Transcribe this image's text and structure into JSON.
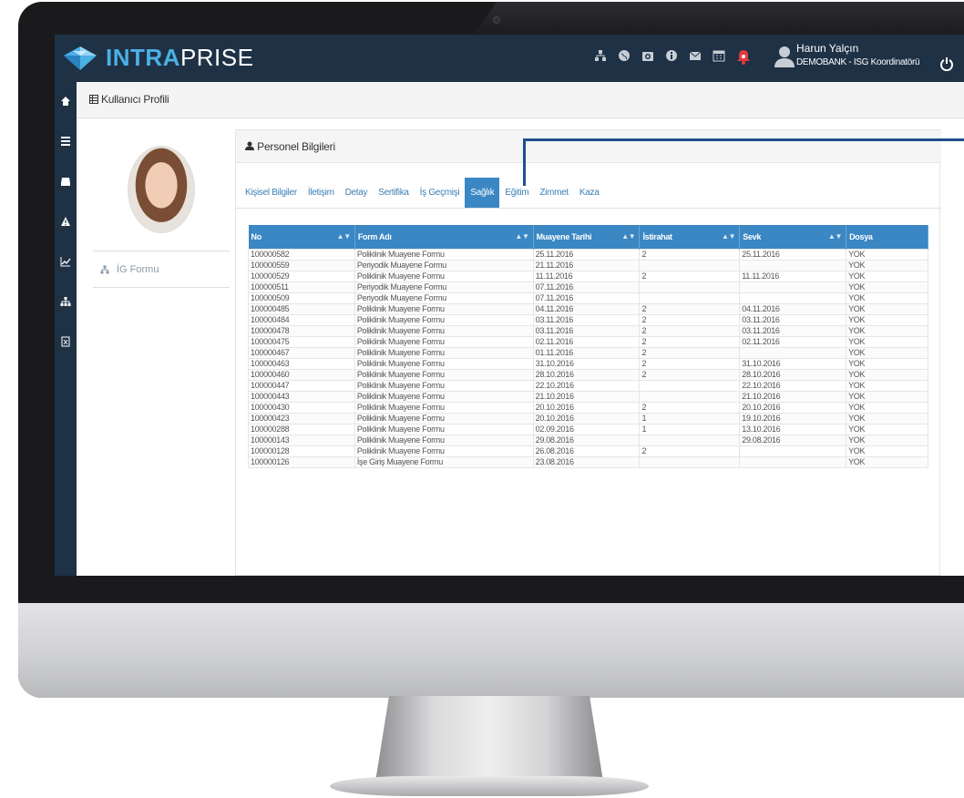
{
  "header": {
    "logo_part1": "INTRA",
    "logo_part2": "PRISE",
    "user_name": "Harun Yalçın",
    "user_role": "DEMOBANK - ISG Koordinatörü",
    "icons": [
      "sitemap-icon",
      "globe-icon",
      "camera-icon",
      "info-icon",
      "envelope-icon",
      "calendar-icon",
      "bell-icon"
    ]
  },
  "sidebar": {
    "icons": [
      "home-icon",
      "list-icon",
      "inbox-icon",
      "warning-icon",
      "chart-icon",
      "org-chart-icon",
      "excel-file-icon"
    ]
  },
  "page": {
    "title": "Kullanıcı Profili"
  },
  "profile": {
    "menu_item": "İG Formu"
  },
  "panel": {
    "title": "Personel Bilgileri"
  },
  "tabs": [
    {
      "label": "Kişisel Bilgiler"
    },
    {
      "label": "İletişim"
    },
    {
      "label": "Detay"
    },
    {
      "label": "Sertifika"
    },
    {
      "label": "İş Geçmişi"
    },
    {
      "label": "Sağlık",
      "active": true
    },
    {
      "label": "Eğitim"
    },
    {
      "label": "Zimmet"
    },
    {
      "label": "Kaza"
    }
  ],
  "table": {
    "columns": [
      "No",
      "Form Adı",
      "Muayene Tarihi",
      "İstirahat",
      "Sevk",
      "Dosya"
    ],
    "rows": [
      [
        "100000582",
        "Poliklinik Muayene Formu",
        "25.11.2016",
        "2",
        "25.11.2016",
        "YOK"
      ],
      [
        "100000559",
        "Periyodik Muayene Formu",
        "21.11.2016",
        "",
        "",
        "YOK"
      ],
      [
        "100000529",
        "Poliklinik Muayene Formu",
        "11.11.2016",
        "2",
        "11.11.2016",
        "YOK"
      ],
      [
        "100000511",
        "Periyodik Muayene Formu",
        "07.11.2016",
        "",
        "",
        "YOK"
      ],
      [
        "100000509",
        "Periyodik Muayene Formu",
        "07.11.2016",
        "",
        "",
        "YOK"
      ],
      [
        "100000485",
        "Poliklinik Muayene Formu",
        "04.11.2016",
        "2",
        "04.11.2016",
        "YOK"
      ],
      [
        "100000484",
        "Poliklinik Muayene Formu",
        "03.11.2016",
        "2",
        "03.11.2016",
        "YOK"
      ],
      [
        "100000478",
        "Poliklinik Muayene Formu",
        "03.11.2016",
        "2",
        "03.11.2016",
        "YOK"
      ],
      [
        "100000475",
        "Poliklinik Muayene Formu",
        "02.11.2016",
        "2",
        "02.11.2016",
        "YOK"
      ],
      [
        "100000467",
        "Poliklinik Muayene Formu",
        "01.11.2016",
        "2",
        "",
        "YOK"
      ],
      [
        "100000463",
        "Poliklinik Muayene Formu",
        "31.10.2016",
        "2",
        "31.10.2016",
        "YOK"
      ],
      [
        "100000460",
        "Poliklinik Muayene Formu",
        "28.10.2016",
        "2",
        "28.10.2016",
        "YOK"
      ],
      [
        "100000447",
        "Poliklinik Muayene Formu",
        "22.10.2016",
        "",
        "22.10.2016",
        "YOK"
      ],
      [
        "100000443",
        "Poliklinik Muayene Formu",
        "21.10.2016",
        "",
        "21.10.2016",
        "YOK"
      ],
      [
        "100000430",
        "Poliklinik Muayene Formu",
        "20.10.2016",
        "2",
        "20.10.2016",
        "YOK"
      ],
      [
        "100000423",
        "Poliklinik Muayene Formu",
        "20.10.2016",
        "1",
        "19.10.2016",
        "YOK"
      ],
      [
        "100000288",
        "Poliklinik Muayene Formu",
        "02.09.2016",
        "1",
        "13.10.2016",
        "YOK"
      ],
      [
        "100000143",
        "Poliklinik Muayene Formu",
        "29.08.2016",
        "",
        "29.08.2016",
        "YOK"
      ],
      [
        "100000128",
        "Poliklinik Muayene Formu",
        "26.08.2016",
        "2",
        "",
        "YOK"
      ],
      [
        "100000126",
        "İşe Giriş Muayene Formu",
        "23.08.2016",
        "",
        "",
        "YOK"
      ]
    ]
  },
  "colors": {
    "topbar": "#1e3145",
    "accent": "#3a87c4",
    "logo_accent": "#4bb0e6",
    "bell": "#e23b3b",
    "pointer": "#1f4e8c"
  }
}
